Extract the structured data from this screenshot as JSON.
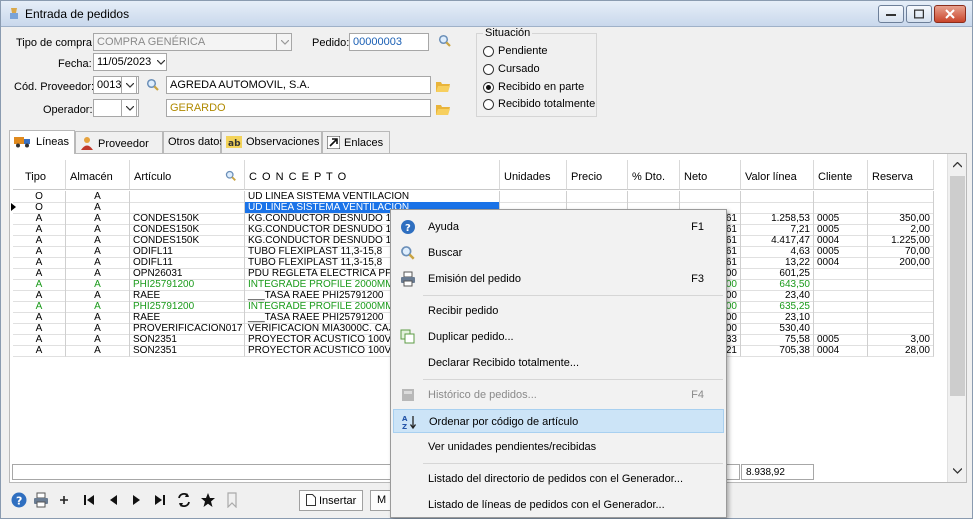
{
  "window": {
    "title": "Entrada de pedidos"
  },
  "form": {
    "tipo_compra_label": "Tipo de compra:",
    "tipo_compra_value": "COMPRA GENÉRICA",
    "pedido_label": "Pedido:",
    "pedido_value": "00000003",
    "fecha_label": "Fecha:",
    "fecha_value": "11/05/2023",
    "proveedor_label": "Cód. Proveedor:",
    "proveedor_code": "0013",
    "proveedor_name": "AGREDA AUTOMOVIL, S.A.",
    "operador_label": "Operador:",
    "operador_name": "GERARDO"
  },
  "situacion": {
    "title": "Situación",
    "options": [
      "Pendiente",
      "Cursado",
      "Recibido en parte",
      "Recibido totalmente"
    ],
    "selected": "Recibido en parte"
  },
  "tabs": [
    {
      "label": "Líneas",
      "icon": "truck-icon"
    },
    {
      "label": "Proveedor",
      "icon": "person-icon"
    },
    {
      "label": "Otros datos",
      "icon": ""
    },
    {
      "label": "Observaciones",
      "icon": "ab-notes-icon"
    },
    {
      "label": "Enlaces",
      "icon": "link-arrow-icon"
    }
  ],
  "grid": {
    "columns": [
      "Tipo",
      "Almacén",
      "Artículo",
      "C O N C E P T O",
      "Unidades",
      "Precio",
      "% Dto.",
      "Neto",
      "Valor línea",
      "Cliente",
      "Reserva"
    ],
    "rows": [
      {
        "tipo": "O",
        "almacen": "A",
        "articulo": "",
        "concepto": "UD LINEA SISTEMA VENTILACION",
        "neto": "",
        "valor": "",
        "cliente": "",
        "reserva": "",
        "green": false
      },
      {
        "tipo": "O",
        "almacen": "A",
        "articulo": "",
        "concepto": "UD LINEA SISTEMA VENTILACION",
        "neto": "",
        "valor": "",
        "cliente": "",
        "reserva": "",
        "green": false,
        "selected": true
      },
      {
        "tipo": "A",
        "almacen": "A",
        "articulo": "CONDES150K",
        "concepto": "KG.CONDUCTOR DESNUDO 1",
        "neto": "61",
        "valor": "1.258,53",
        "cliente": "0005",
        "reserva": "350,00",
        "green": false
      },
      {
        "tipo": "A",
        "almacen": "A",
        "articulo": "CONDES150K",
        "concepto": "KG.CONDUCTOR DESNUDO 1",
        "neto": "61",
        "valor": "7,21",
        "cliente": "0005",
        "reserva": "2,00",
        "green": false
      },
      {
        "tipo": "A",
        "almacen": "A",
        "articulo": "CONDES150K",
        "concepto": "KG.CONDUCTOR DESNUDO 1",
        "neto": "61",
        "valor": "4.417,47",
        "cliente": "0004",
        "reserva": "1.225,00",
        "green": false
      },
      {
        "tipo": "A",
        "almacen": "A",
        "articulo": "ODIFL11",
        "concepto": "TUBO FLEXIPLAST 11,3-15,8",
        "neto": "61",
        "valor": "4,63",
        "cliente": "0005",
        "reserva": "70,00",
        "green": false
      },
      {
        "tipo": "A",
        "almacen": "A",
        "articulo": "ODIFL11",
        "concepto": "TUBO FLEXIPLAST 11,3-15,8",
        "neto": "61",
        "valor": "13,22",
        "cliente": "0004",
        "reserva": "200,00",
        "green": false
      },
      {
        "tipo": "A",
        "almacen": "A",
        "articulo": "OPN26031",
        "concepto": "PDU REGLETA ELECTRICA PF",
        "neto": "00",
        "valor": "601,25",
        "cliente": "",
        "reserva": "",
        "green": false
      },
      {
        "tipo": "A",
        "almacen": "A",
        "articulo": "PHI25791200",
        "concepto": "INTEGRADE PROFILE 2000MM",
        "neto": "00",
        "valor": "643,50",
        "cliente": "",
        "reserva": "",
        "green": true
      },
      {
        "tipo": "A",
        "almacen": "A",
        "articulo": "RAEE",
        "concepto": "___TASA RAEE PHI25791200",
        "neto": "00",
        "valor": "23,40",
        "cliente": "",
        "reserva": "",
        "green": false
      },
      {
        "tipo": "A",
        "almacen": "A",
        "articulo": "PHI25791200",
        "concepto": "INTEGRADE PROFILE 2000MM",
        "neto": "00",
        "valor": "635,25",
        "cliente": "",
        "reserva": "",
        "green": true
      },
      {
        "tipo": "A",
        "almacen": "A",
        "articulo": "RAEE",
        "concepto": "___TASA RAEE PHI25791200",
        "neto": "00",
        "valor": "23,10",
        "cliente": "",
        "reserva": "",
        "green": false
      },
      {
        "tipo": "A",
        "almacen": "A",
        "articulo": "PROVERIFICACION017",
        "concepto": "VERIFICACION MIA3000C. CAJA",
        "neto": "00",
        "valor": "530,40",
        "cliente": "",
        "reserva": "",
        "green": false
      },
      {
        "tipo": "A",
        "almacen": "A",
        "articulo": "SON2351",
        "concepto": "PROYECTOR ACUSTICO 100V",
        "neto": "33",
        "valor": "75,58",
        "cliente": "0005",
        "reserva": "3,00",
        "green": false
      },
      {
        "tipo": "A",
        "almacen": "A",
        "articulo": "SON2351",
        "concepto": "PROYECTOR ACUSTICO 100V",
        "neto": "21",
        "valor": "705,38",
        "cliente": "0004",
        "reserva": "28,00",
        "green": false
      }
    ],
    "total": "8.938,92"
  },
  "toolbar": {
    "insert_label": "Insertar",
    "partial_label": "M"
  },
  "context_menu": {
    "items": [
      {
        "label": "Ayuda",
        "key": "F1",
        "icon": "help-icon",
        "disabled": false
      },
      {
        "label": "Buscar",
        "key": "",
        "icon": "search-icon",
        "disabled": false
      },
      {
        "label": "Emisión del pedido",
        "key": "F3",
        "icon": "printer-icon",
        "disabled": false
      },
      {
        "label": "Recibir pedido",
        "key": "",
        "icon": "",
        "disabled": false
      },
      {
        "label": "Duplicar pedido...",
        "key": "",
        "icon": "duplicate-icon",
        "disabled": false
      },
      {
        "label": "Declarar Recibido totalmente...",
        "key": "",
        "icon": "",
        "disabled": false
      },
      {
        "label": "Histórico de pedidos...",
        "key": "F4",
        "icon": "history-icon",
        "disabled": true
      },
      {
        "label": "Ordenar por código de artículo",
        "key": "",
        "icon": "sort-az-icon",
        "disabled": false,
        "highlighted": true
      },
      {
        "label": "Ver unidades pendientes/recibidas",
        "key": "",
        "icon": "",
        "disabled": false
      },
      {
        "label": "Listado del directorio de pedidos con el Generador...",
        "key": "",
        "icon": "",
        "disabled": false
      },
      {
        "label": "Listado de líneas de pedidos con el Generador...",
        "key": "",
        "icon": "",
        "disabled": false
      }
    ]
  },
  "colors": {
    "selection": "#1a73e8",
    "green_row": "#1a9a1a",
    "menu_highlight": "#cce4f7",
    "field_text": "#1a5fb4"
  }
}
